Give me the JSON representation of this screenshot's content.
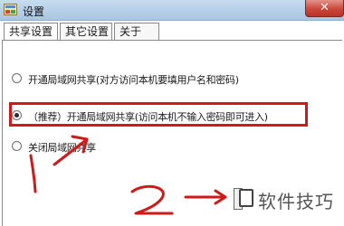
{
  "window": {
    "title": "设置"
  },
  "tabs": [
    {
      "label": "共享设置"
    },
    {
      "label": "其它设置"
    },
    {
      "label": "关于"
    }
  ],
  "options": [
    {
      "label": "开通局域网共享(对方访问本机要填用户名和密码)",
      "checked": false
    },
    {
      "label": "（推荐）开通局域网共享(访问本机不输入密码即可进入)",
      "checked": true
    },
    {
      "label": "关闭局域网共享",
      "checked": false
    }
  ],
  "watermark": {
    "text": "软件技巧"
  },
  "colors": {
    "highlight": "#d01a1a",
    "close_button": "#c9473a",
    "titlebar": "#a9c5e2"
  }
}
